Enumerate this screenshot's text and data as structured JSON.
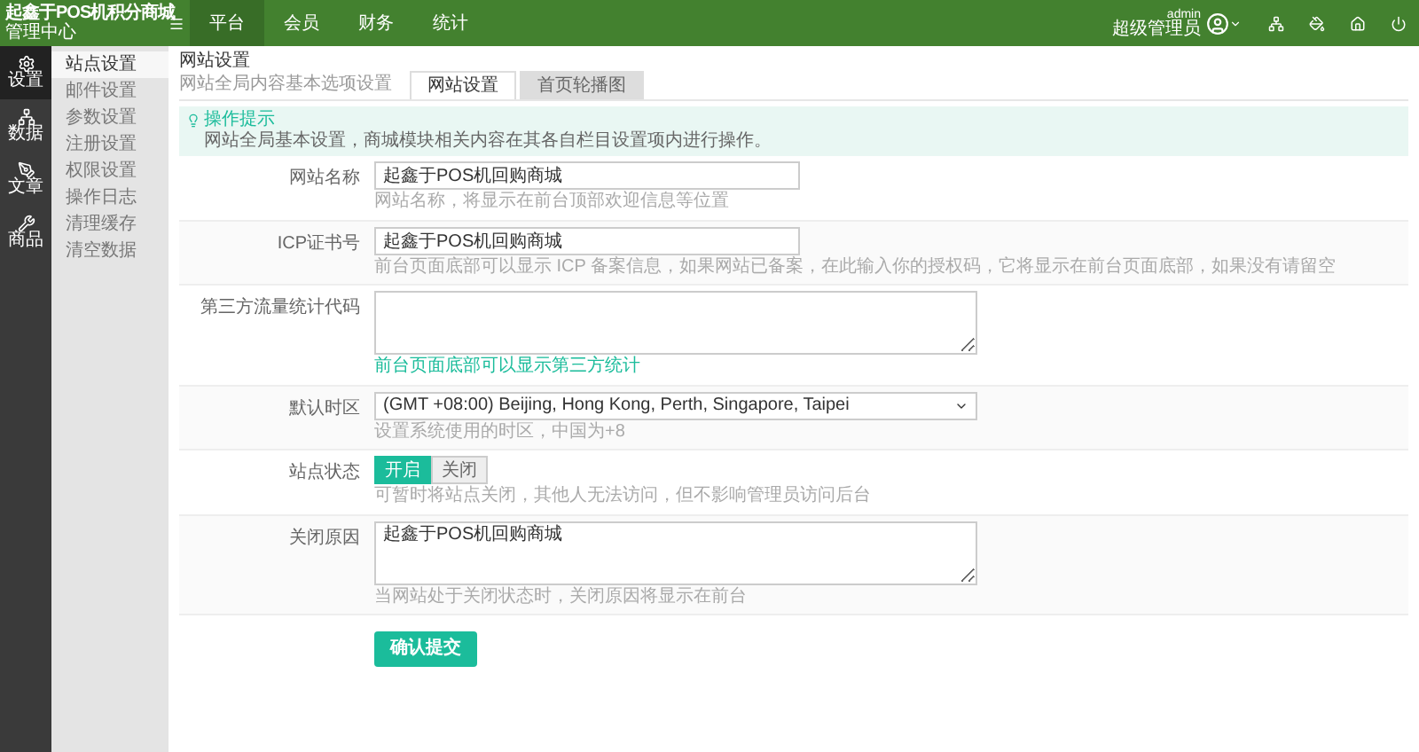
{
  "brand": {
    "title": "起鑫于POS机积分商城",
    "subtitle": "管理中心"
  },
  "top_nav": [
    {
      "label": "平台",
      "selected": true
    },
    {
      "label": "会员",
      "selected": false
    },
    {
      "label": "财务",
      "selected": false
    },
    {
      "label": "统计",
      "selected": false
    }
  ],
  "user": {
    "name": "admin",
    "role": "超级管理员"
  },
  "side_icons": [
    {
      "label": "设置",
      "selected": true,
      "kind": "gear"
    },
    {
      "label": "数据",
      "selected": false,
      "kind": "sitemap"
    },
    {
      "label": "文章",
      "selected": false,
      "kind": "pen"
    },
    {
      "label": "商品",
      "selected": false,
      "kind": "tools"
    }
  ],
  "side_menu": [
    {
      "label": "站点设置",
      "selected": true
    },
    {
      "label": "邮件设置",
      "selected": false
    },
    {
      "label": "参数设置",
      "selected": false
    },
    {
      "label": "注册设置",
      "selected": false
    },
    {
      "label": "权限设置",
      "selected": false
    },
    {
      "label": "操作日志",
      "selected": false
    },
    {
      "label": "清理缓存",
      "selected": false
    },
    {
      "label": "清空数据",
      "selected": false
    }
  ],
  "page": {
    "title": "网站设置",
    "subtitle": "网站全局内容基本选项设置"
  },
  "tabs": [
    {
      "label": "网站设置",
      "selected": true
    },
    {
      "label": "首页轮播图",
      "selected": false
    }
  ],
  "tip": {
    "title": "操作提示",
    "text": "网站全局基本设置，商城模块相关内容在其各自栏目设置项内进行操作。"
  },
  "form": [
    {
      "kind": "input",
      "label": "网站名称",
      "value": "起鑫于POS机回购商城",
      "hint": "网站名称，将显示在前台顶部欢迎信息等位置"
    },
    {
      "kind": "input",
      "label": "ICP证书号",
      "value": "起鑫于POS机回购商城",
      "hint": "前台页面底部可以显示 ICP 备案信息，如果网站已备案，在此输入你的授权码，它将显示在前台页面底部，如果没有请留空"
    },
    {
      "kind": "textarea",
      "label": "第三方流量统计代码",
      "hint": "前台页面底部可以显示第三方统计",
      "hint_accent": true
    },
    {
      "kind": "select",
      "label": "默认时区",
      "value": "(GMT +08:00) Beijing, Hong Kong, Perth, Singapore, Taipei",
      "hint": "设置系统使用的时区，中国为+8"
    },
    {
      "kind": "toggle",
      "label": "站点状态",
      "options": [
        {
          "label": "开启",
          "selected": true
        },
        {
          "label": "关闭",
          "selected": false
        }
      ],
      "hint": "可暂时将站点关闭，其他人无法访问，但不影响管理员访问后台"
    },
    {
      "kind": "textarea",
      "label": "关闭原因",
      "value": "起鑫于POS机回购商城",
      "hint": "当网站处于关闭状态时，关闭原因将显示在前台"
    }
  ],
  "submit": "确认提交"
}
